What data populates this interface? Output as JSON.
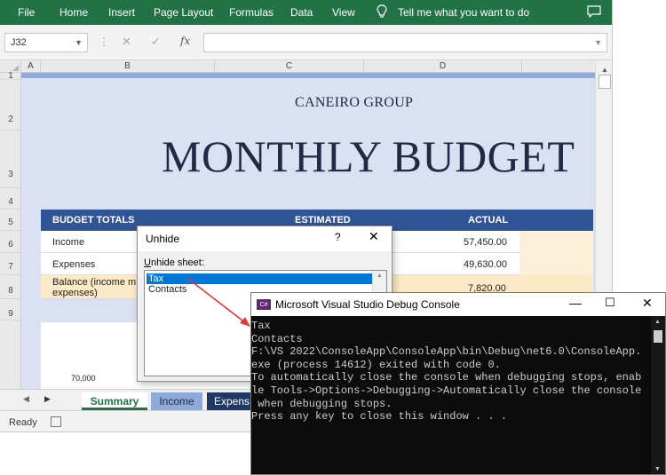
{
  "ribbon": {
    "tabs": [
      "File",
      "Home",
      "Insert",
      "Page Layout",
      "Formulas",
      "Data",
      "View"
    ],
    "tell_me": "Tell me what you want to do"
  },
  "formula_bar": {
    "name_box": "J32",
    "value": ""
  },
  "columns": [
    "A",
    "B",
    "C",
    "D"
  ],
  "rows": [
    "1",
    "2",
    "3",
    "4",
    "5",
    "6",
    "7",
    "8",
    "9"
  ],
  "sheet": {
    "company": "CANEIRO GROUP",
    "title": "MONTHLY BUDGET",
    "table_headers": {
      "totals": "BUDGET TOTALS",
      "estimated": "ESTIMATED",
      "actual": "ACTUAL"
    },
    "table_rows": [
      {
        "label": "Income",
        "actual": "57,450.00"
      },
      {
        "label": "Expenses",
        "actual": "49,630.00"
      },
      {
        "label": "Balance (income m\nexpenses)",
        "actual": "7,820.00"
      }
    ],
    "chart_ylabel": "70,000"
  },
  "sheet_tabs": [
    "Summary",
    "Income",
    "Expens"
  ],
  "status": {
    "ready": "Ready"
  },
  "dialog": {
    "title": "Unhide",
    "help": "?",
    "label_u": "U",
    "label_rest": "nhide sheet:",
    "items": [
      "Tax",
      "Contacts"
    ]
  },
  "console": {
    "title": "Microsoft Visual Studio Debug Console",
    "icon_text": "C#",
    "lines": [
      "Tax",
      "Contacts",
      "",
      "F:\\VS 2022\\ConsoleApp\\ConsoleApp\\bin\\Debug\\net6.0\\ConsoleApp.",
      "exe (process 14612) exited with code 0.",
      "To automatically close the console when debugging stops, enab",
      "le Tools->Options->Debugging->Automatically close the console",
      " when debugging stops.",
      "Press any key to close this window . . ."
    ]
  },
  "colors": {
    "excel_green": "#217346",
    "header_blue": "#2f5597",
    "band_blue": "#8eaadb",
    "area_blue": "#d9e1f2",
    "console_bg": "#0c0c0c",
    "annotation_red": "#e03a3a"
  }
}
